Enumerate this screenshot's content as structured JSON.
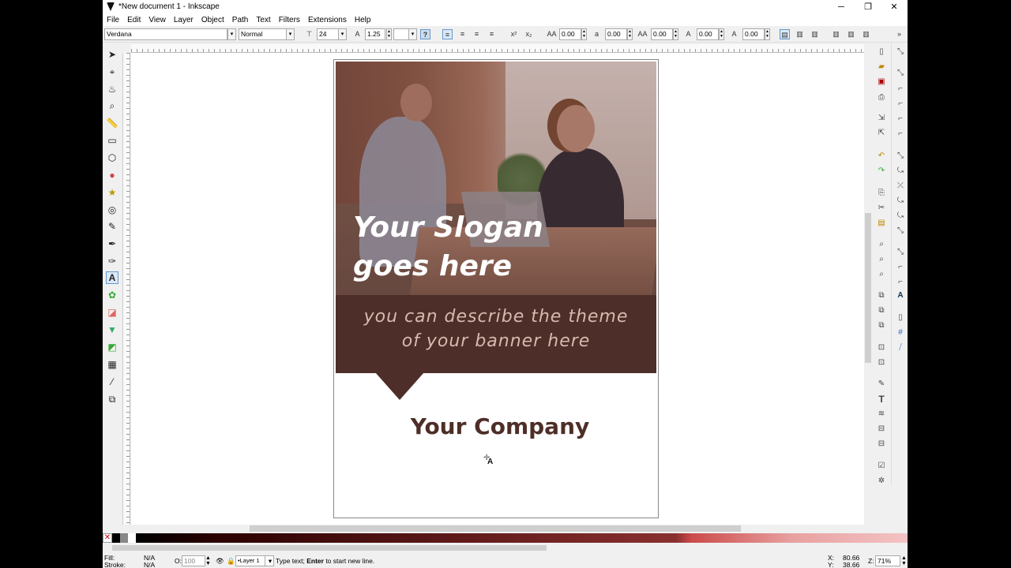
{
  "window": {
    "title": "*New document 1 - Inkscape",
    "minimize": "─",
    "restore": "❐",
    "close": "✕"
  },
  "menu": [
    "File",
    "Edit",
    "View",
    "Layer",
    "Object",
    "Path",
    "Text",
    "Filters",
    "Extensions",
    "Help"
  ],
  "text_toolbar": {
    "font_family": "Verdana",
    "font_style": "Normal",
    "font_size": "24",
    "line_spacing": "1.25",
    "letter_spacing": "0.00",
    "word_spacing": "0.00",
    "kerning": "0.00",
    "vertical_shift": "0.00",
    "rotation": "0.00",
    "help_icon": "?"
  },
  "canvas": {
    "slogan_line1": "Your Slogan",
    "slogan_line2": "goes here",
    "desc_line1": "you can describe the theme",
    "desc_line2": "of your banner here",
    "company": "Your Company",
    "cursor_glyph": "A"
  },
  "palette": {
    "none_glyph": "✕"
  },
  "status": {
    "fill_label": "Fill:",
    "fill_value": "N/A",
    "stroke_label": "Stroke:",
    "stroke_value": "N/A",
    "opacity_label": "O:",
    "opacity_value": "100",
    "layer": "•Layer 1",
    "message_pre": "Type text; ",
    "message_key": "Enter",
    "message_post": " to start new line.",
    "x_label": "X:",
    "x_value": "80.66",
    "y_label": "Y:",
    "y_value": "38.66",
    "zoom_label": "Z:",
    "zoom_value": "71%"
  },
  "colors": {
    "brand_brown": "#4e2e28",
    "desc_text": "#d8b9b0"
  }
}
